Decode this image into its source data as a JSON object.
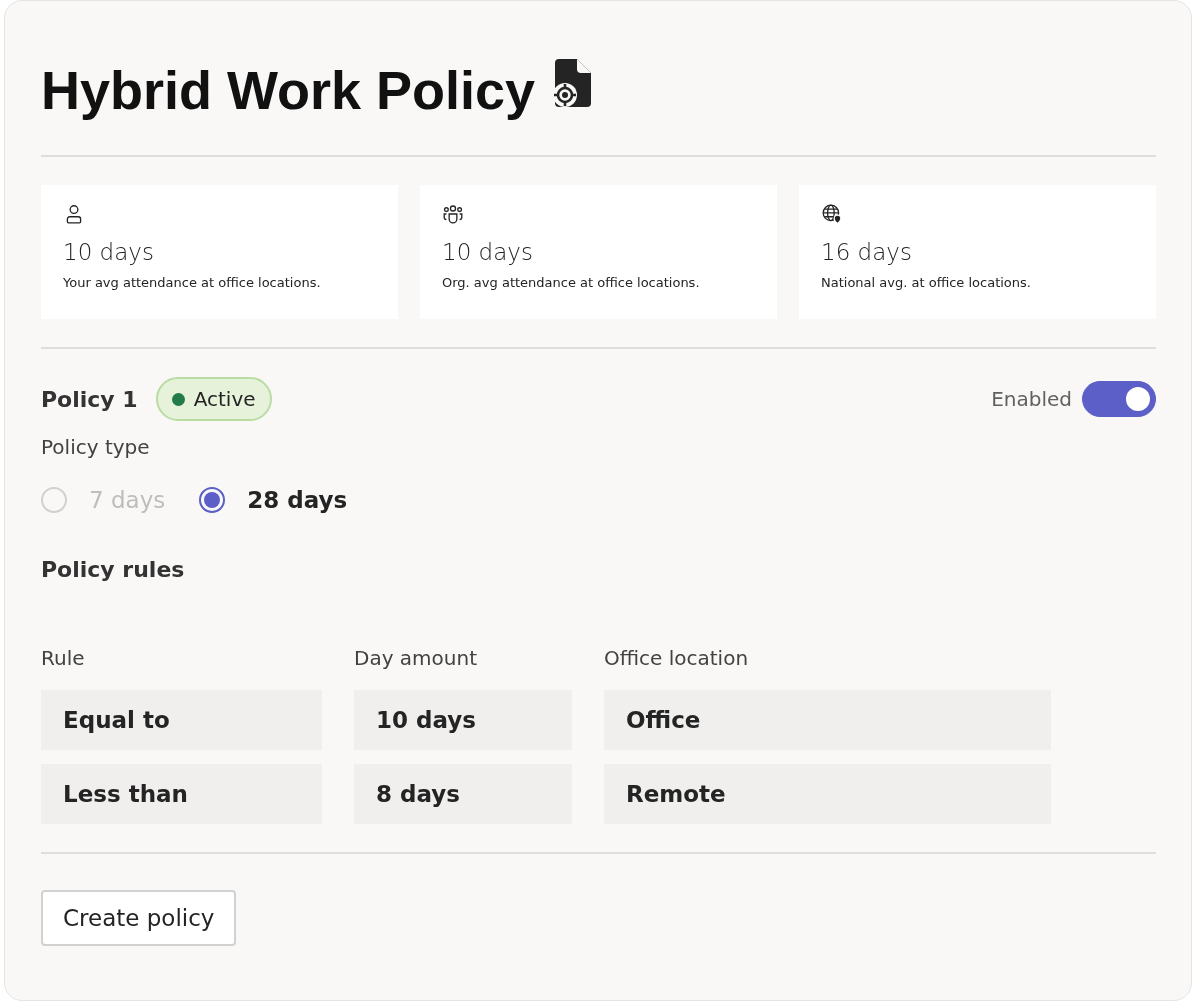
{
  "title": "Hybrid Work Policy",
  "stats": [
    {
      "kind": "person",
      "value": "10 days",
      "caption": "Your avg attendance at office locations."
    },
    {
      "kind": "people",
      "value": "10 days",
      "caption": "Org. avg attendance at office locations."
    },
    {
      "kind": "globe",
      "value": "16 days",
      "caption": "National avg. at office locations."
    }
  ],
  "policy": {
    "name": "Policy 1",
    "status": {
      "label": "Active",
      "color": "#237b4b"
    },
    "toggle": {
      "label": "Enabled",
      "on": true
    },
    "type_label": "Policy type",
    "options": [
      {
        "label": "7 days",
        "selected": false,
        "disabled": true
      },
      {
        "label": "28 days",
        "selected": true,
        "disabled": false
      }
    ],
    "rules_title": "Policy rules",
    "columns": [
      "Rule",
      "Day amount",
      "Office location"
    ],
    "rows": [
      [
        "Equal to",
        "10 days",
        "Office"
      ],
      [
        "Less than",
        "8 days",
        "Remote"
      ]
    ]
  },
  "button": "Create policy"
}
